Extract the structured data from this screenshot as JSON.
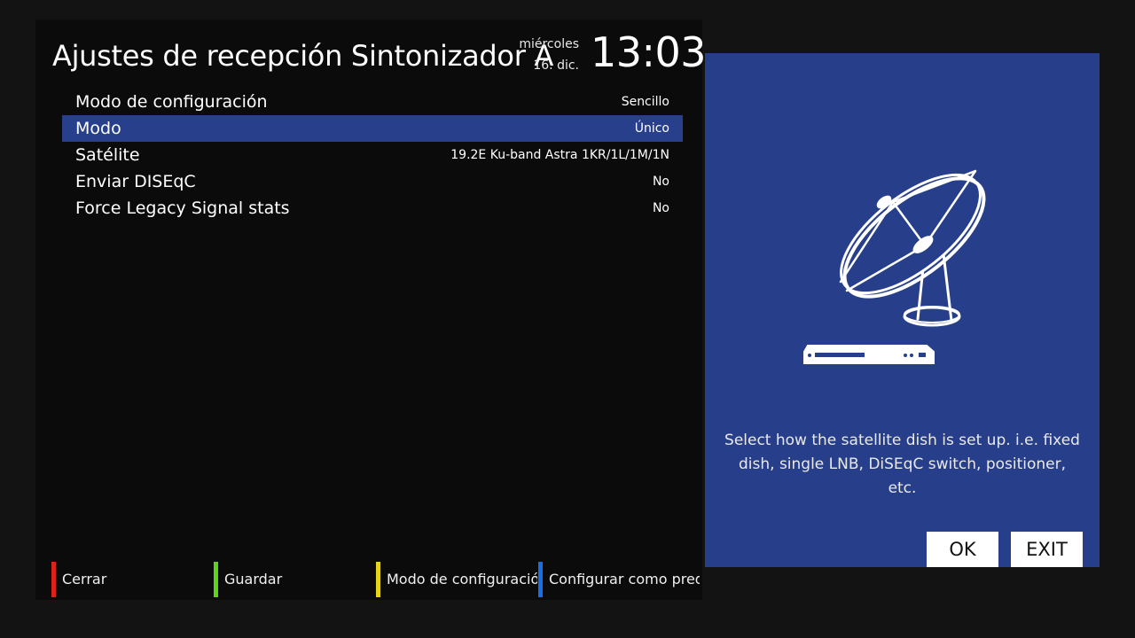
{
  "header": {
    "title": "Ajustes de recepción Sintonizador A",
    "weekday": "miércoles",
    "date": "16. dic.",
    "time": "13:03"
  },
  "settings": [
    {
      "label": "Modo de configuración",
      "value": "Sencillo",
      "selected": false
    },
    {
      "label": "Modo",
      "value": "Único",
      "selected": true
    },
    {
      "label": "Satélite",
      "value": "19.2E Ku-band Astra 1KR/1L/1M/1N",
      "selected": false
    },
    {
      "label": "Enviar DISEqC",
      "value": "No",
      "selected": false
    },
    {
      "label": "Force Legacy Signal stats",
      "value": "No",
      "selected": false
    }
  ],
  "color_buttons": {
    "red": {
      "label": "Cerrar",
      "color": "#e0201a"
    },
    "green": {
      "label": "Guardar",
      "color": "#5fd31a"
    },
    "yellow": {
      "label": "Modo de configuración",
      "color": "#e4d51a"
    },
    "blue": {
      "label": "Configurar como pred",
      "color": "#1a6ee0"
    }
  },
  "help": {
    "icon": "satellite-dish-icon",
    "text": "Select how the satellite dish is set up. i.e. fixed dish, single LNB, DiSEqC switch, positioner, etc.",
    "ok_label": "OK",
    "exit_label": "EXIT"
  },
  "colors": {
    "background": "#131313",
    "panel": "#0b0b0b",
    "selection": "#283f8c",
    "help_panel": "#273f8a"
  }
}
